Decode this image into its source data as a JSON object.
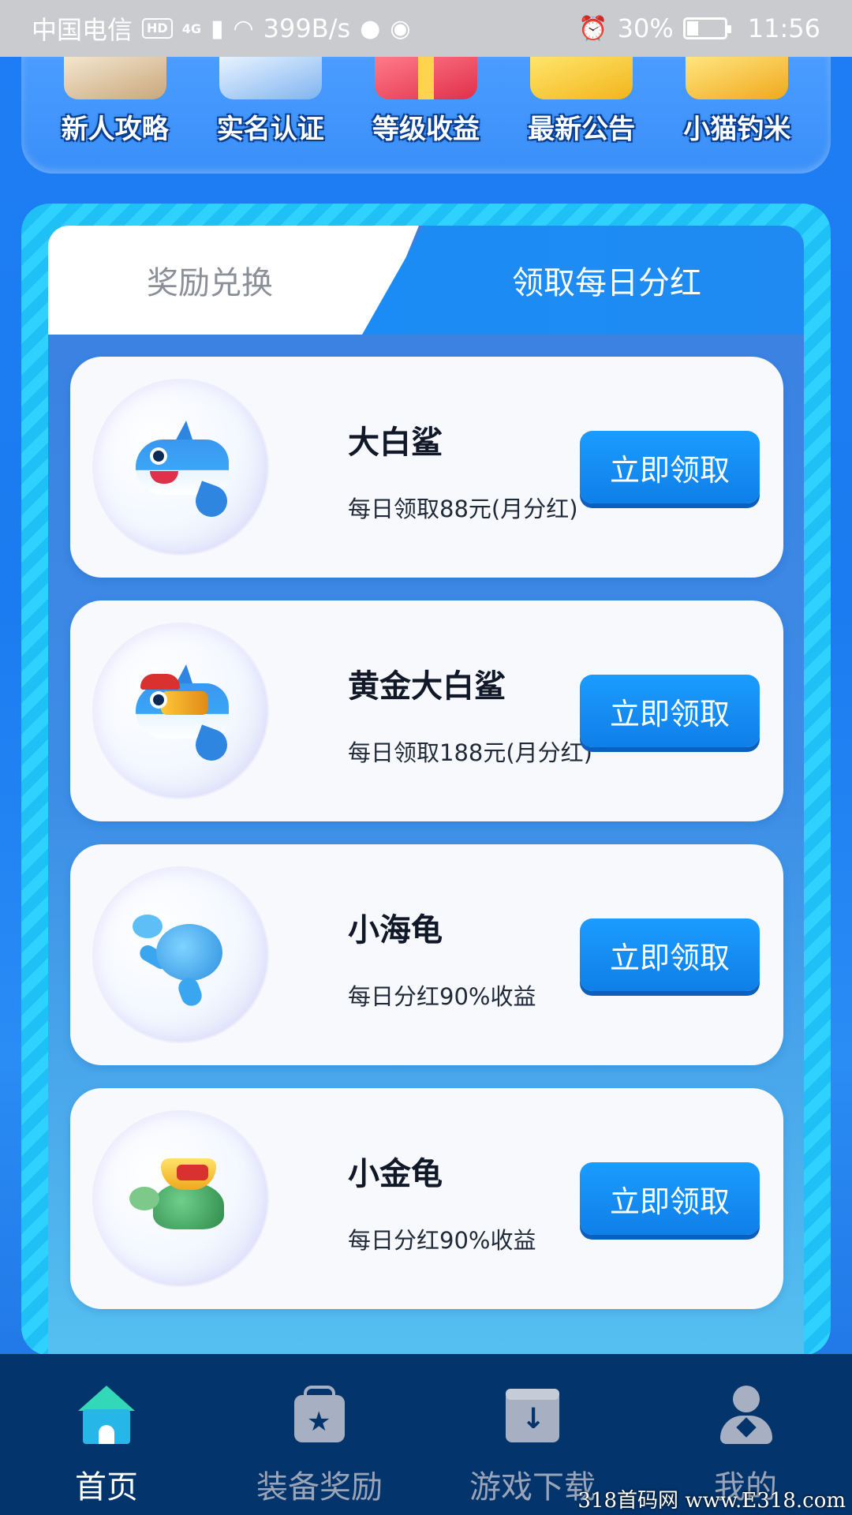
{
  "status_bar": {
    "carrier": "中国电信",
    "hd_badge": "HD",
    "network": "4G",
    "speed": "399B/s",
    "battery": "30%",
    "battery_level": 0.3,
    "time": "11:56",
    "icons": [
      "signal-icon",
      "wifi-icon",
      "qq-icon",
      "wechat-icon",
      "alarm-icon",
      "battery-icon"
    ]
  },
  "shortcuts": [
    {
      "label": "新人攻略",
      "icon": "guide-book-icon"
    },
    {
      "label": "实名认证",
      "icon": "id-card-icon"
    },
    {
      "label": "等级收益",
      "icon": "gift-box-icon"
    },
    {
      "label": "最新公告",
      "icon": "envelope-icon"
    },
    {
      "label": "小猫钓米",
      "icon": "gold-coins-icon"
    }
  ],
  "tabs": {
    "left": "奖励兑换",
    "right": "领取每日分红",
    "active": "right"
  },
  "rewards": [
    {
      "title": "大白鲨",
      "desc": "每日领取88元(月分红)",
      "button": "立即领取",
      "icon": "great-white-shark-icon"
    },
    {
      "title": "黄金大白鲨",
      "desc": "每日领取188元(月分红)",
      "button": "立即领取",
      "icon": "golden-shark-icon"
    },
    {
      "title": "小海龟",
      "desc": "每日分红90%收益",
      "button": "立即领取",
      "icon": "sea-turtle-icon"
    },
    {
      "title": "小金龟",
      "desc": "每日分红90%收益",
      "button": "立即领取",
      "icon": "golden-turtle-icon"
    }
  ],
  "bottom_nav": [
    {
      "label": "首页",
      "icon": "home-icon",
      "active": true
    },
    {
      "label": "装备奖励",
      "icon": "gift-icon",
      "active": false
    },
    {
      "label": "游戏下载",
      "icon": "download-icon",
      "active": false
    },
    {
      "label": "我的",
      "icon": "profile-icon",
      "active": false
    }
  ],
  "colors": {
    "accent": "#1b8cf5",
    "nav_bg": "#03346b",
    "frame": "#2fd2ff",
    "button": "#0f7fe8"
  },
  "watermark": "318首码网 www.E318.com"
}
